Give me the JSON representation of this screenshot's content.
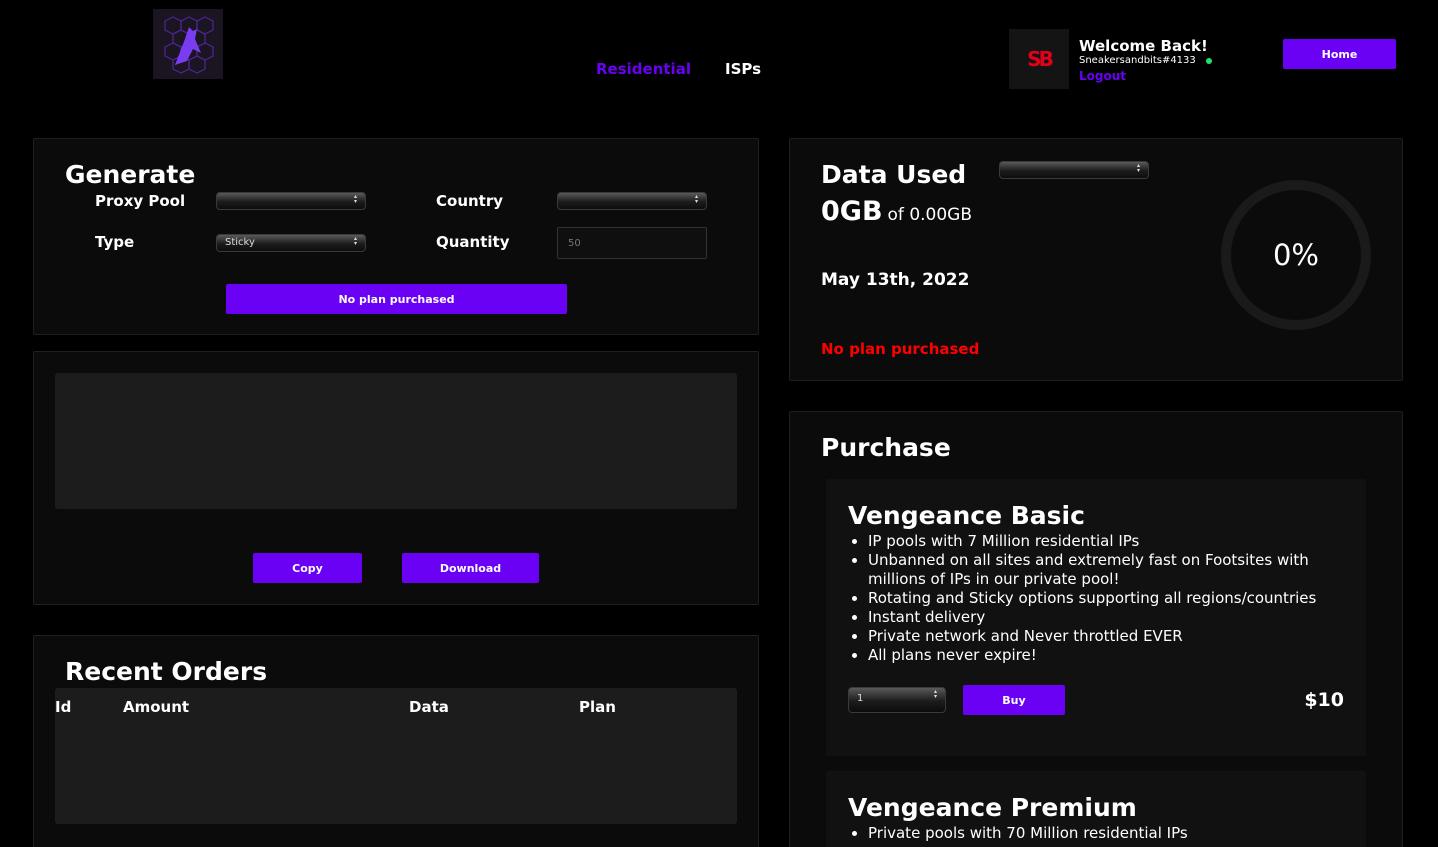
{
  "header": {
    "logo_icon": "wolf-hexagon-logo-icon",
    "nav": [
      {
        "label": "Residential",
        "active": true
      },
      {
        "label": "ISPs",
        "active": false
      }
    ],
    "avatar_text": "SB",
    "welcome": "Welcome Back!",
    "username": "Sneakersandbits#4133",
    "logout": "Logout",
    "home": "Home"
  },
  "generate": {
    "title": "Generate",
    "proxy_pool_label": "Proxy Pool",
    "proxy_pool_value": "",
    "country_label": "Country",
    "country_value": "",
    "type_label": "Type",
    "type_value": "Sticky",
    "quantity_label": "Quantity",
    "quantity_placeholder": "50",
    "submit": "No plan purchased"
  },
  "output": {
    "copy": "Copy",
    "download": "Download"
  },
  "orders": {
    "title": "Recent Orders",
    "columns": [
      "Id",
      "Amount",
      "Data",
      "Plan"
    ]
  },
  "data_used": {
    "title": "Data Used",
    "used": "0GB",
    "total": "of 0.00GB",
    "date": "May 13th, 2022",
    "status": "No plan purchased",
    "percent": "0%",
    "plan_select": ""
  },
  "purchase": {
    "title": "Purchase",
    "plans": [
      {
        "name": "Vengeance Basic",
        "features": [
          "IP pools with 7 Million residential IPs",
          "Unbanned on all sites and extremely fast on Footsites with millions of IPs in our private pool!",
          "Rotating and Sticky options supporting all regions/countries",
          "Instant delivery",
          "Private network and Never throttled EVER",
          "All plans never expire!"
        ],
        "qty": "1",
        "buy": "Buy",
        "price": "$10"
      },
      {
        "name": "Vengeance Premium",
        "features": [
          "Private pools with 70 Million residential IPs"
        ]
      }
    ]
  },
  "colors": {
    "accent": "#6a00f4",
    "danger": "#ff0000",
    "online": "#1fe26a"
  }
}
